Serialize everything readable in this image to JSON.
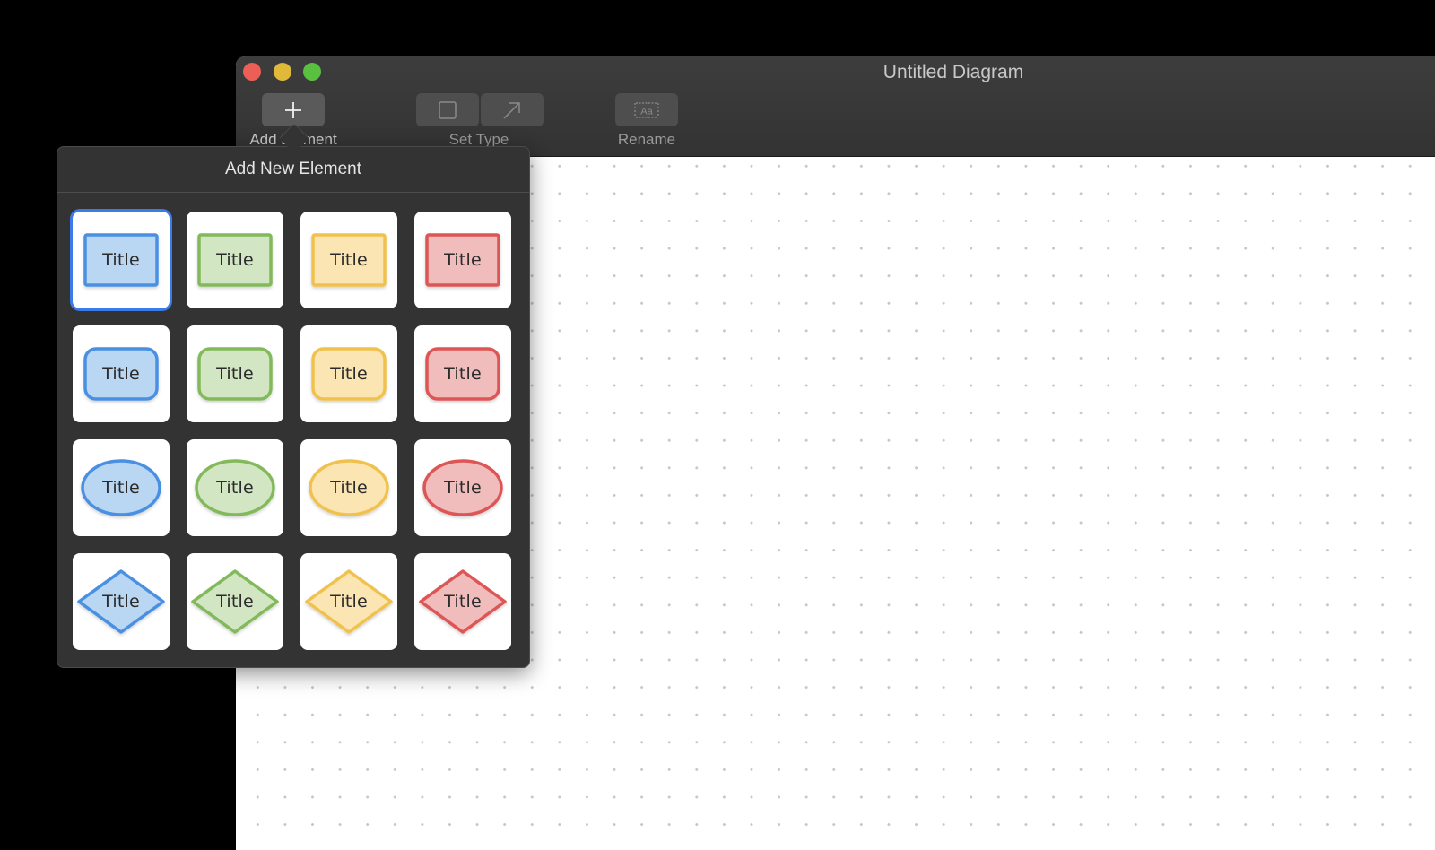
{
  "window": {
    "title": "Untitled Diagram",
    "traffic_lights": [
      "close",
      "minimize",
      "zoom"
    ]
  },
  "toolbar": {
    "add_element": {
      "label": "Add Element",
      "icon": "plus-icon",
      "enabled": true
    },
    "set_type": {
      "label": "Set Type",
      "icons": [
        "square-icon",
        "arrow-up-right-icon"
      ],
      "enabled": false
    },
    "rename": {
      "label": "Rename",
      "icon": "text-field-icon",
      "icon_text": "Aa",
      "enabled": false
    }
  },
  "popover": {
    "title": "Add New Element",
    "selected_index": 0,
    "colors": {
      "blue": {
        "stroke": "#4a90e2",
        "fill": "#b9d6f2"
      },
      "green": {
        "stroke": "#82b95a",
        "fill": "#d3e6c4"
      },
      "yellow": {
        "stroke": "#f0c24e",
        "fill": "#fbe5b2"
      },
      "red": {
        "stroke": "#de5454",
        "fill": "#f0bcbc"
      }
    },
    "elements": [
      {
        "shape": "rectangle",
        "color": "blue",
        "label": "Title"
      },
      {
        "shape": "rectangle",
        "color": "green",
        "label": "Title"
      },
      {
        "shape": "rectangle",
        "color": "yellow",
        "label": "Title"
      },
      {
        "shape": "rectangle",
        "color": "red",
        "label": "Title"
      },
      {
        "shape": "rounded-rectangle",
        "color": "blue",
        "label": "Title"
      },
      {
        "shape": "rounded-rectangle",
        "color": "green",
        "label": "Title"
      },
      {
        "shape": "rounded-rectangle",
        "color": "yellow",
        "label": "Title"
      },
      {
        "shape": "rounded-rectangle",
        "color": "red",
        "label": "Title"
      },
      {
        "shape": "ellipse",
        "color": "blue",
        "label": "Title"
      },
      {
        "shape": "ellipse",
        "color": "green",
        "label": "Title"
      },
      {
        "shape": "ellipse",
        "color": "yellow",
        "label": "Title"
      },
      {
        "shape": "ellipse",
        "color": "red",
        "label": "Title"
      },
      {
        "shape": "diamond",
        "color": "blue",
        "label": "Title"
      },
      {
        "shape": "diamond",
        "color": "green",
        "label": "Title"
      },
      {
        "shape": "diamond",
        "color": "yellow",
        "label": "Title"
      },
      {
        "shape": "diamond",
        "color": "red",
        "label": "Title"
      }
    ]
  },
  "canvas": {
    "background": "dot-grid"
  }
}
